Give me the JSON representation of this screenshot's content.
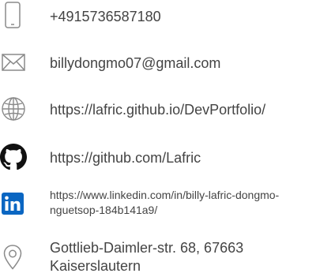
{
  "contacts": {
    "phone": {
      "icon": "phone-icon",
      "text": "+4915736587180"
    },
    "email": {
      "icon": "mail-icon",
      "text": "billydongmo07@gmail.com"
    },
    "website": {
      "icon": "globe-icon",
      "text": "https://lafric.github.io/DevPortfolio/"
    },
    "github": {
      "icon": "github-icon",
      "text": "https://github.com/Lafric"
    },
    "linkedin": {
      "icon": "linkedin-icon",
      "text": "https://www.linkedin.com/in/billy-lafric-dongmo-nguetsop-184b141a9/"
    },
    "address": {
      "icon": "location-pin-icon",
      "text": "Gottlieb-Daimler-str. 68, 67663 Kaiserslautern"
    }
  },
  "colors": {
    "text": "#444444",
    "icon_outline": "#8a8a8a",
    "github": "#111111",
    "linkedin": "#0a66c2"
  }
}
